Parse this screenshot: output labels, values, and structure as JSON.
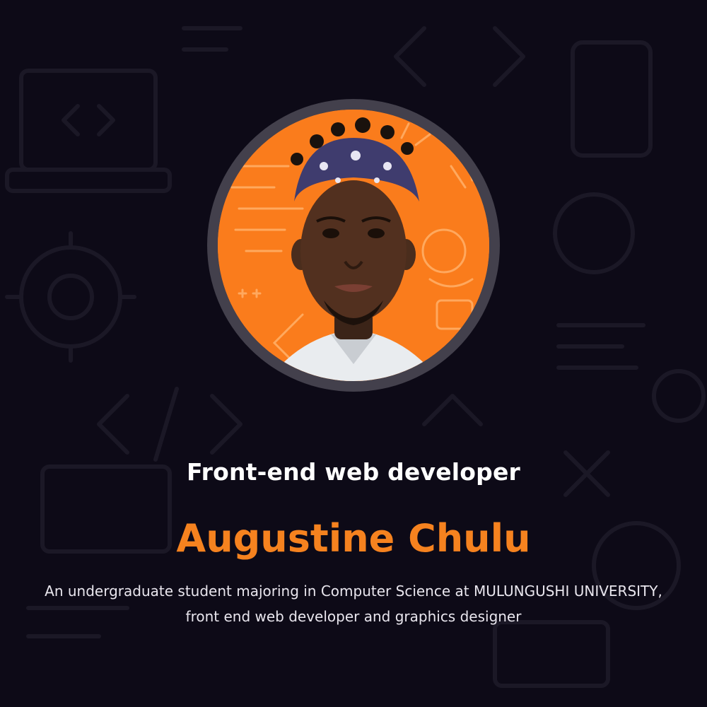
{
  "profile": {
    "role": "Front-end web developer",
    "name": "Augustine Chulu",
    "bio_line_1": "An undergraduate student majoring in Computer Science at MULUNGUSHI UNIVERSITY,",
    "bio_line_2": "front end web developer and graphics designer",
    "avatar_icon": "profile-photo"
  },
  "colors": {
    "background": "#0d0a17",
    "accent": "#f5821f",
    "ring": "#43404c",
    "text": "#ffffff"
  }
}
